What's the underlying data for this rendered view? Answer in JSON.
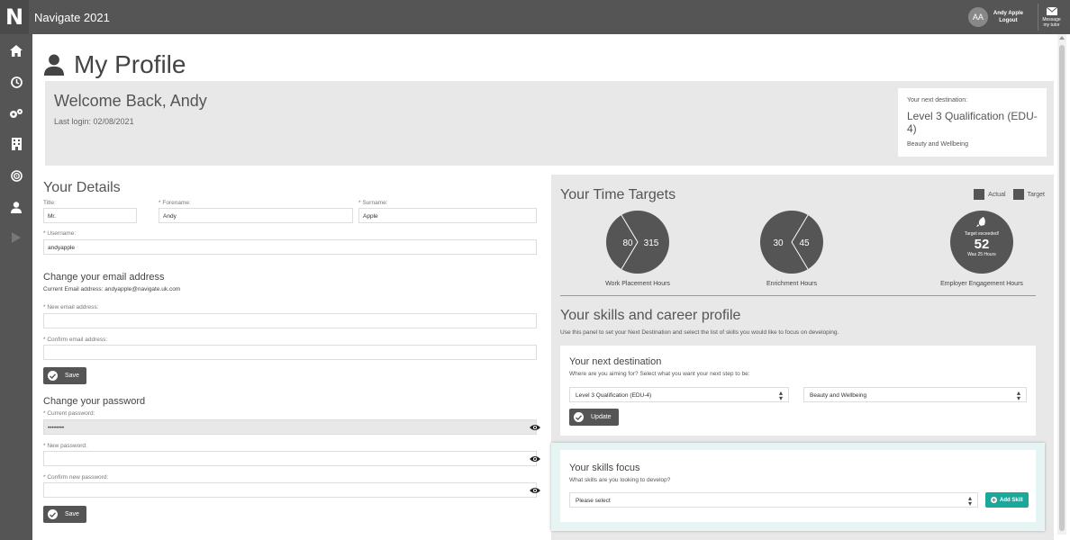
{
  "app": {
    "logo_letter": "N",
    "title": "Navigate 2021"
  },
  "user": {
    "initials": "AA",
    "name": "Andy Apple",
    "logout": "Logout",
    "message_line1": "Message",
    "message_line2": "my tutor"
  },
  "page": {
    "title": "My Profile"
  },
  "welcome": {
    "heading": "Welcome Back, Andy",
    "last_login": "Last login: 02/08/2021",
    "dest_label": "Your next destination:",
    "dest_title": "Level 3 Qualification (EDU-4)",
    "dest_sub": "Beauty and Wellbeing"
  },
  "details": {
    "heading": "Your Details",
    "title_label": "Title:",
    "title_value": "Mr.",
    "forename_label": "Forename:",
    "forename_value": "Andy",
    "surname_label": "Surname:",
    "surname_value": "Apple",
    "username_label": "Username:",
    "username_value": "andyapple",
    "email_heading": "Change your email address",
    "current_email_label": "Current Email address:",
    "current_email_value": "andyapple@navigate.uk.com",
    "new_email_label": "New email address:",
    "confirm_email_label": "Confirm email address:",
    "save_label": "Save",
    "password_heading": "Change your password",
    "current_pw_label": "Current password:",
    "current_pw_value": "••••••••",
    "new_pw_label": "New password:",
    "confirm_pw_label": "Confirm new password:",
    "save2_label": "Save",
    "required_mark": "*"
  },
  "time_targets": {
    "heading": "Your Time Targets",
    "legend_actual": "Actual",
    "legend_target": "Target",
    "work": {
      "actual": "80",
      "target": "315",
      "label": "Work Placement Hours"
    },
    "enrich": {
      "actual": "30",
      "target": "45",
      "label": "Enrichment Hours"
    },
    "employer": {
      "exceeded": "Target exceeded!",
      "value": "52",
      "was": "Was 25 Hours",
      "label": "Employer Engagement Hours"
    }
  },
  "skills": {
    "heading": "Your skills and career profile",
    "description": "Use this panel to set your Next Destination and select the list of skills you would like to focus on developing.",
    "next_dest_heading": "Your next destination",
    "next_dest_sub": "Where are you aiming for? Select what you want your next step to be:",
    "qual_select": "Level 3 Qualification (EDU-4)",
    "area_select": "Beauty and Wellbeing",
    "update_label": "Update",
    "focus_heading": "Your skills focus",
    "focus_sub": "What skills are you looking to develop?",
    "focus_select": "Please select",
    "add_skill_label": "Add Skill"
  },
  "colors": {
    "sidebar": "#555555",
    "panel": "#e8e8e8",
    "teal": "#1aa89a",
    "circle": "#555555"
  },
  "icons": [
    "home-icon",
    "clock-icon",
    "cogs-icon",
    "building-icon",
    "target-icon",
    "user-icon",
    "play-icon",
    "eye-icon",
    "check-icon",
    "envelope-icon",
    "rocket-icon"
  ]
}
